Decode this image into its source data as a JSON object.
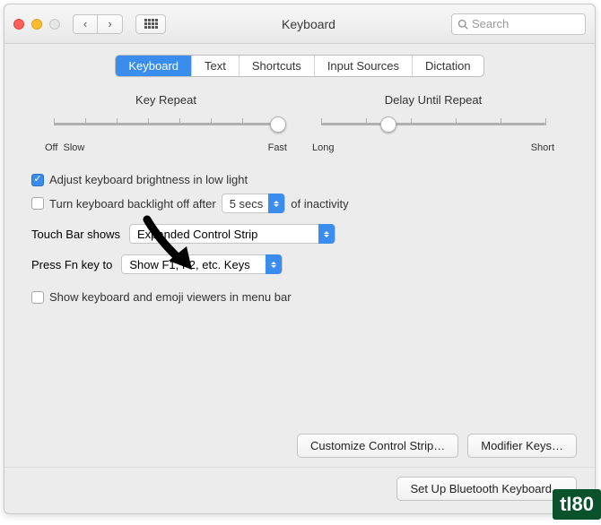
{
  "window": {
    "title": "Keyboard"
  },
  "search": {
    "placeholder": "Search"
  },
  "tabs": [
    "Keyboard",
    "Text",
    "Shortcuts",
    "Input Sources",
    "Dictation"
  ],
  "sliders": {
    "repeat": {
      "label": "Key Repeat",
      "left": "Off",
      "left2": "Slow",
      "right": "Fast"
    },
    "delay": {
      "label": "Delay Until Repeat",
      "left": "Long",
      "right": "Short"
    }
  },
  "checks": {
    "brightness": "Adjust keyboard brightness in low light",
    "backlight_off_prefix": "Turn keyboard backlight off after",
    "backlight_off_suffix": "of inactivity",
    "backlight_select": "5 secs",
    "viewers": "Show keyboard and emoji viewers in menu bar"
  },
  "touchbar": {
    "label": "Touch Bar shows",
    "value": "Expanded Control Strip"
  },
  "fnkey": {
    "label": "Press Fn key to",
    "value": "Show F1, F2, etc. Keys"
  },
  "buttons": {
    "customize": "Customize Control Strip…",
    "modifier": "Modifier Keys…",
    "bluetooth": "Set Up Bluetooth Keyboard…"
  },
  "badge": "tI80"
}
